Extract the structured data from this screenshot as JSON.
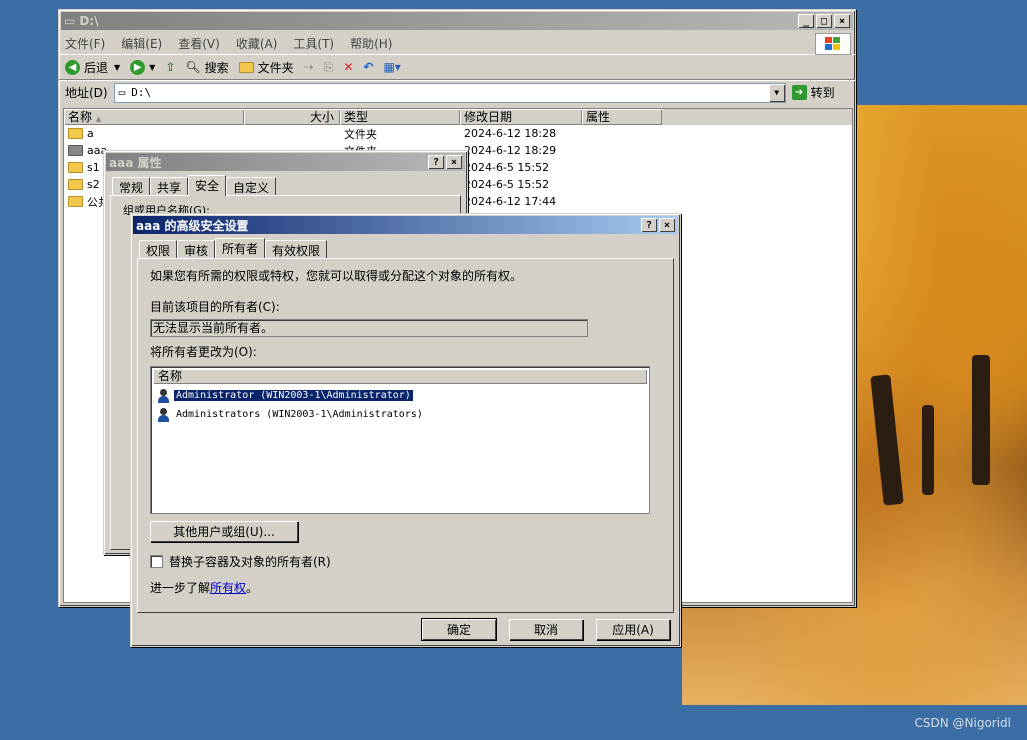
{
  "explorer": {
    "title": "D:\\",
    "menu": [
      "文件(F)",
      "编辑(E)",
      "查看(V)",
      "收藏(A)",
      "工具(T)",
      "帮助(H)"
    ],
    "toolbar": {
      "back": "后退",
      "search": "搜索",
      "folders": "文件夹"
    },
    "address_label": "地址(D)",
    "address_value": "D:\\",
    "goto_label": "转到",
    "columns": [
      "名称",
      "大小",
      "类型",
      "修改日期",
      "属性"
    ],
    "files": [
      {
        "name": "a",
        "type": "文件夹",
        "modified": "2024-6-12 18:28"
      },
      {
        "name": "aaa",
        "type": "文件夹",
        "modified": "2024-6-12 18:29"
      },
      {
        "name": "s1",
        "type": "",
        "modified": "2024-6-5 15:52"
      },
      {
        "name": "s2",
        "type": "",
        "modified": "2024-6-5 15:52"
      },
      {
        "name": "公共",
        "type": "",
        "modified": "2024-6-12 17:44"
      }
    ]
  },
  "props": {
    "title": "aaa 属性",
    "tabs": [
      "常规",
      "共享",
      "安全",
      "自定义"
    ],
    "partial_label": "组或用户名称(G):"
  },
  "adv": {
    "title": "aaa 的高级安全设置",
    "tabs": [
      "权限",
      "审核",
      "所有者",
      "有效权限"
    ],
    "intro": "如果您有所需的权限或特权，您就可以取得或分配这个对象的所有权。",
    "current_owner_label": "目前该项目的所有者(C):",
    "current_owner_value": "无法显示当前所有者。",
    "change_owner_label": "将所有者更改为(O):",
    "list_header": "名称",
    "owners": [
      "Administrator (WIN2003-1\\Administrator)",
      "Administrators (WIN2003-1\\Administrators)"
    ],
    "other_users_button": "其他用户或组(U)...",
    "replace_checkbox": "替换子容器及对象的所有者(R)",
    "learn_more_prefix": "进一步了解",
    "learn_more_link": "所有权",
    "learn_more_suffix": "。",
    "ok": "确定",
    "cancel": "取消",
    "apply": "应用(A)"
  },
  "watermark": "CSDN @Nigoridl"
}
